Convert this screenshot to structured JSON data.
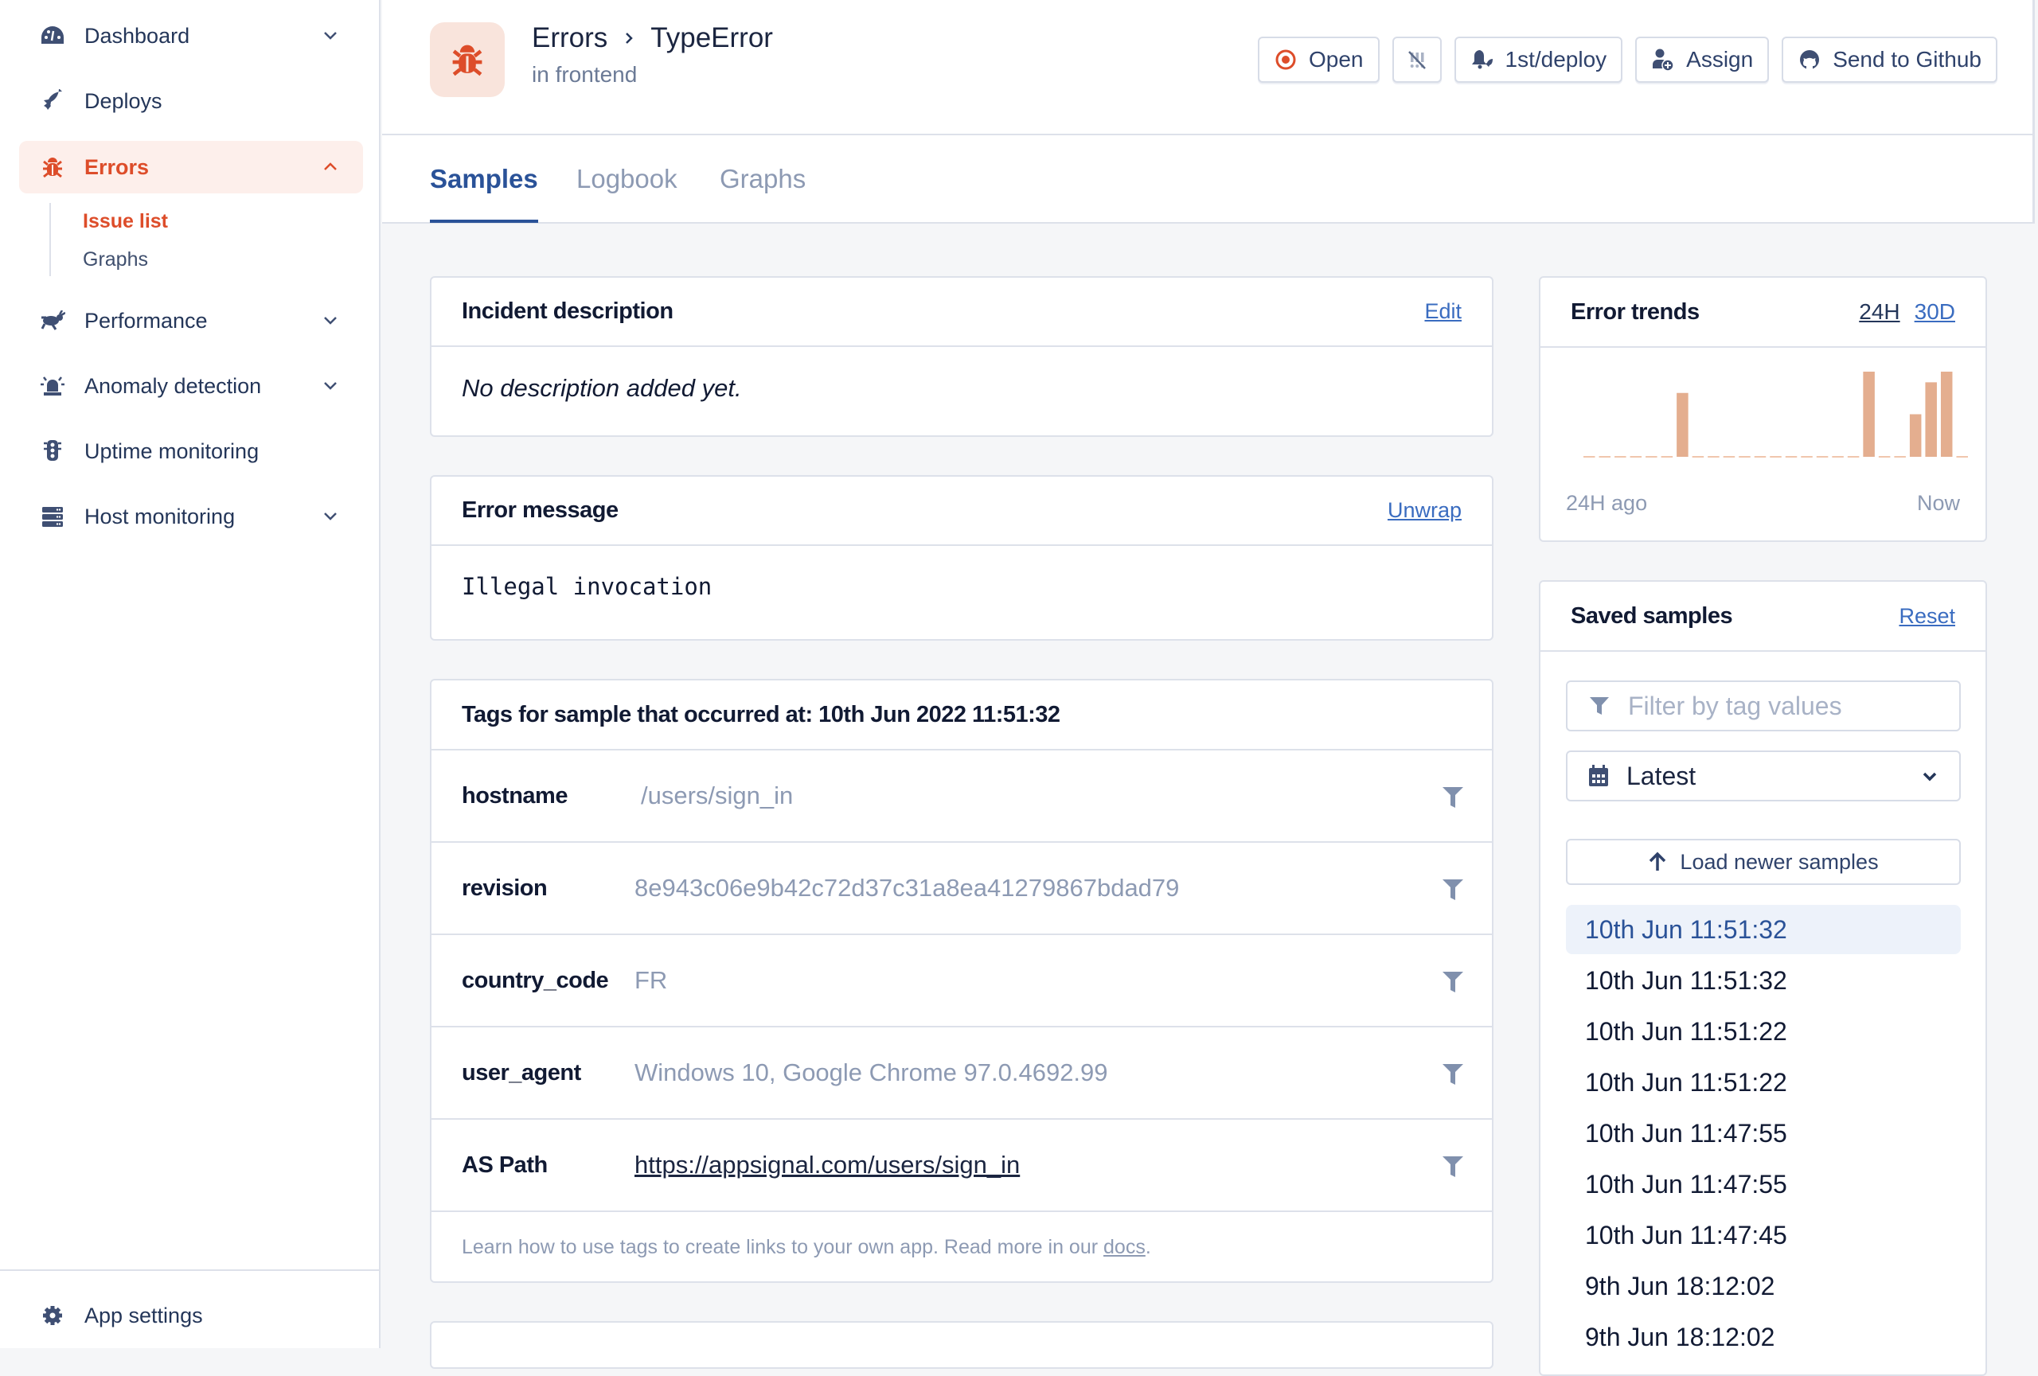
{
  "sidebar": {
    "items": [
      {
        "label": "Dashboard",
        "icon": "dashboard-icon",
        "expandable": true
      },
      {
        "label": "Deploys",
        "icon": "rocket-icon",
        "expandable": false
      },
      {
        "label": "Errors",
        "icon": "bug-icon",
        "expandable": true,
        "active": true
      },
      {
        "label": "Performance",
        "icon": "rabbit-icon",
        "expandable": true
      },
      {
        "label": "Anomaly detection",
        "icon": "siren-icon",
        "expandable": true
      },
      {
        "label": "Uptime monitoring",
        "icon": "traffic-light-icon",
        "expandable": false
      },
      {
        "label": "Host monitoring",
        "icon": "server-icon",
        "expandable": true
      }
    ],
    "errors_sub": [
      {
        "label": "Issue list",
        "active": true
      },
      {
        "label": "Graphs",
        "active": false
      }
    ],
    "app_settings": "App settings"
  },
  "header": {
    "breadcrumb_parent": "Errors",
    "breadcrumb_current": "TypeError",
    "subtitle": "in frontend",
    "buttons": {
      "open": "Open",
      "notify": "1st/deploy",
      "assign": "Assign",
      "github": "Send to Github"
    }
  },
  "tabs": [
    "Samples",
    "Logbook",
    "Graphs"
  ],
  "active_tab": "Samples",
  "incident": {
    "title": "Incident description",
    "edit": "Edit",
    "body": "No description added yet."
  },
  "error_message": {
    "title": "Error message",
    "unwrap": "Unwrap",
    "body": "Illegal invocation"
  },
  "tags": {
    "title": "Tags for sample that occurred at: 10th Jun 2022 11:51:32",
    "rows": [
      {
        "key": "hostname",
        "value": "/users/sign_in",
        "link": false
      },
      {
        "key": "revision",
        "value": "8e943c06e9b42c72d37c31a8ea41279867bdad79",
        "link": false
      },
      {
        "key": "country_code",
        "value": "FR",
        "link": false
      },
      {
        "key": "user_agent",
        "value": "Windows 10, Google Chrome 97.0.4692.99",
        "link": false
      },
      {
        "key": "AS Path",
        "value": "https://appsignal.com/users/sign_in",
        "link": true
      }
    ],
    "footer_text": "Learn how to use tags to create links to your own app. Read more in our ",
    "footer_link": "docs",
    "footer_end": "."
  },
  "error_trends": {
    "title": "Error trends",
    "range_24h": "24H",
    "range_30d": "30D",
    "start_label": "24H ago",
    "end_label": "Now"
  },
  "chart_data": {
    "type": "bar",
    "title": "Error trends",
    "xlabel": "",
    "ylabel": "",
    "x_start_label": "24H ago",
    "x_end_label": "Now",
    "values": [
      0,
      0,
      0,
      0,
      0,
      0,
      6,
      0,
      0,
      0,
      0,
      0,
      0,
      0,
      0,
      0,
      0,
      0,
      8,
      0,
      0,
      4,
      7,
      8,
      0
    ],
    "ylim": [
      0,
      8
    ],
    "color": "#e4ae8f"
  },
  "saved_samples": {
    "title": "Saved samples",
    "reset": "Reset",
    "filter_placeholder": "Filter by tag values",
    "sort_selected": "Latest",
    "load_newer": "Load newer samples",
    "items": [
      "10th Jun 11:51:32",
      "10th Jun 11:51:32",
      "10th Jun 11:51:22",
      "10th Jun 11:51:22",
      "10th Jun 11:47:55",
      "10th Jun 11:47:55",
      "10th Jun 11:47:45",
      "9th Jun 18:12:02",
      "9th Jun 18:12:02"
    ],
    "active_index": 0
  },
  "colors": {
    "accent": "#dd4d2a",
    "link": "#3a6cc0",
    "primary": "#2a5298",
    "bar": "#e4ae8f"
  }
}
